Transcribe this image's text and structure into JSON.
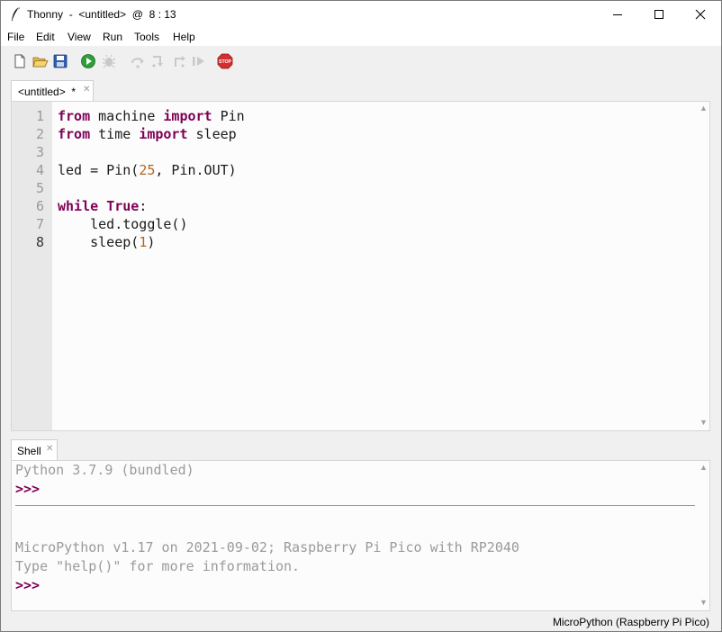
{
  "window": {
    "title": "Thonny  -  <untitled>  @  8 : 13"
  },
  "menu": [
    "File",
    "Edit",
    "View",
    "Run",
    "Tools",
    "Help"
  ],
  "toolbar": {
    "buttons": [
      "new-file",
      "open-file",
      "save-file",
      "run-script",
      "debug-script",
      "step-over",
      "step-into",
      "step-out",
      "resume",
      "stop"
    ]
  },
  "editor": {
    "tab_label": "<untitled>  *",
    "line_numbers": [
      "1",
      "2",
      "3",
      "4",
      "5",
      "6",
      "7",
      "8"
    ],
    "current_line": "8"
  },
  "shell": {
    "tab_label": "Shell",
    "lines": {
      "banner1": "Python 3.7.9 (bundled)",
      "prompt1": ">>>",
      "banner2": "MicroPython v1.17 on 2021-09-02; Raspberry Pi Pico with RP2040",
      "banner3": "Type \"help()\" for more information.",
      "prompt2": ">>>"
    }
  },
  "status": {
    "interpreter": "MicroPython (Raspberry Pi Pico)"
  },
  "colors": {
    "keyword": "#7f0055",
    "number": "#b5651d",
    "stop": "#d32f2f",
    "run": "#2e9e3a"
  }
}
